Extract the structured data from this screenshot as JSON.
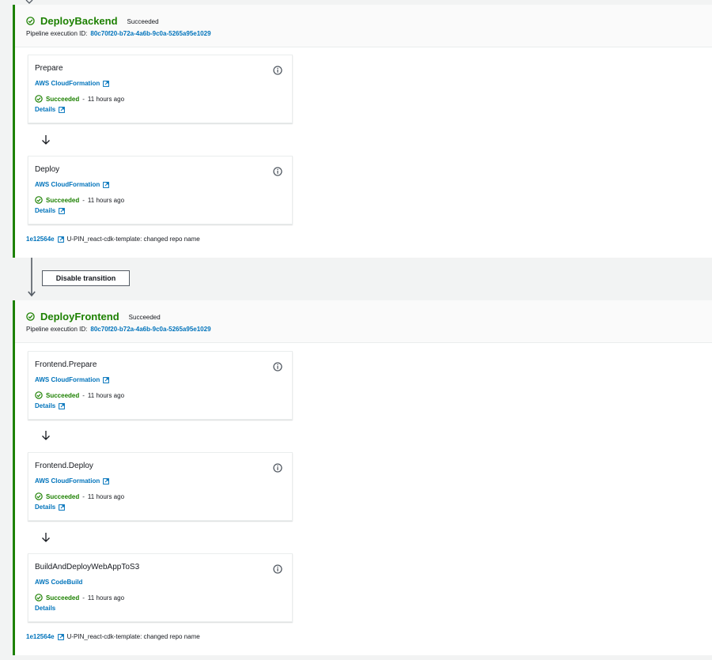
{
  "stages": [
    {
      "name": "DeployBackend",
      "status": "Succeeded",
      "exec_label": "Pipeline execution ID:",
      "exec_id": "80c70f20-b72a-4a6b-9c0a-5265a95e1029",
      "actions": [
        {
          "name": "Prepare",
          "provider": "AWS CloudFormation",
          "status": "Succeeded",
          "dash": "-",
          "time": "11 hours ago",
          "details": "Details"
        },
        {
          "name": "Deploy",
          "provider": "AWS CloudFormation",
          "status": "Succeeded",
          "dash": "-",
          "time": "11 hours ago",
          "details": "Details"
        }
      ],
      "commit": {
        "id": "1e12564e",
        "message": "U-PIN_react-cdk-template: changed repo name"
      }
    },
    {
      "name": "DeployFrontend",
      "status": "Succeeded",
      "exec_label": "Pipeline execution ID:",
      "exec_id": "80c70f20-b72a-4a6b-9c0a-5265a95e1029",
      "actions": [
        {
          "name": "Frontend.Prepare",
          "provider": "AWS CloudFormation",
          "status": "Succeeded",
          "dash": "-",
          "time": "11 hours ago",
          "details": "Details"
        },
        {
          "name": "Frontend.Deploy",
          "provider": "AWS CloudFormation",
          "status": "Succeeded",
          "dash": "-",
          "time": "11 hours ago",
          "details": "Details"
        },
        {
          "name": "BuildAndDeployWebAppToS3",
          "provider": "AWS CodeBuild",
          "status": "Succeeded",
          "dash": "-",
          "time": "11 hours ago",
          "details": "Details"
        }
      ],
      "commit": {
        "id": "1e12564e",
        "message": "U-PIN_react-cdk-template: changed repo name"
      }
    }
  ],
  "transition": {
    "label": "Disable transition"
  },
  "colors": {
    "success": "#1d8102",
    "link": "#0073bb",
    "border": "#eaeded"
  },
  "icons": [
    "check-circle-icon",
    "external-link-icon",
    "info-icon",
    "arrow-down-icon"
  ]
}
